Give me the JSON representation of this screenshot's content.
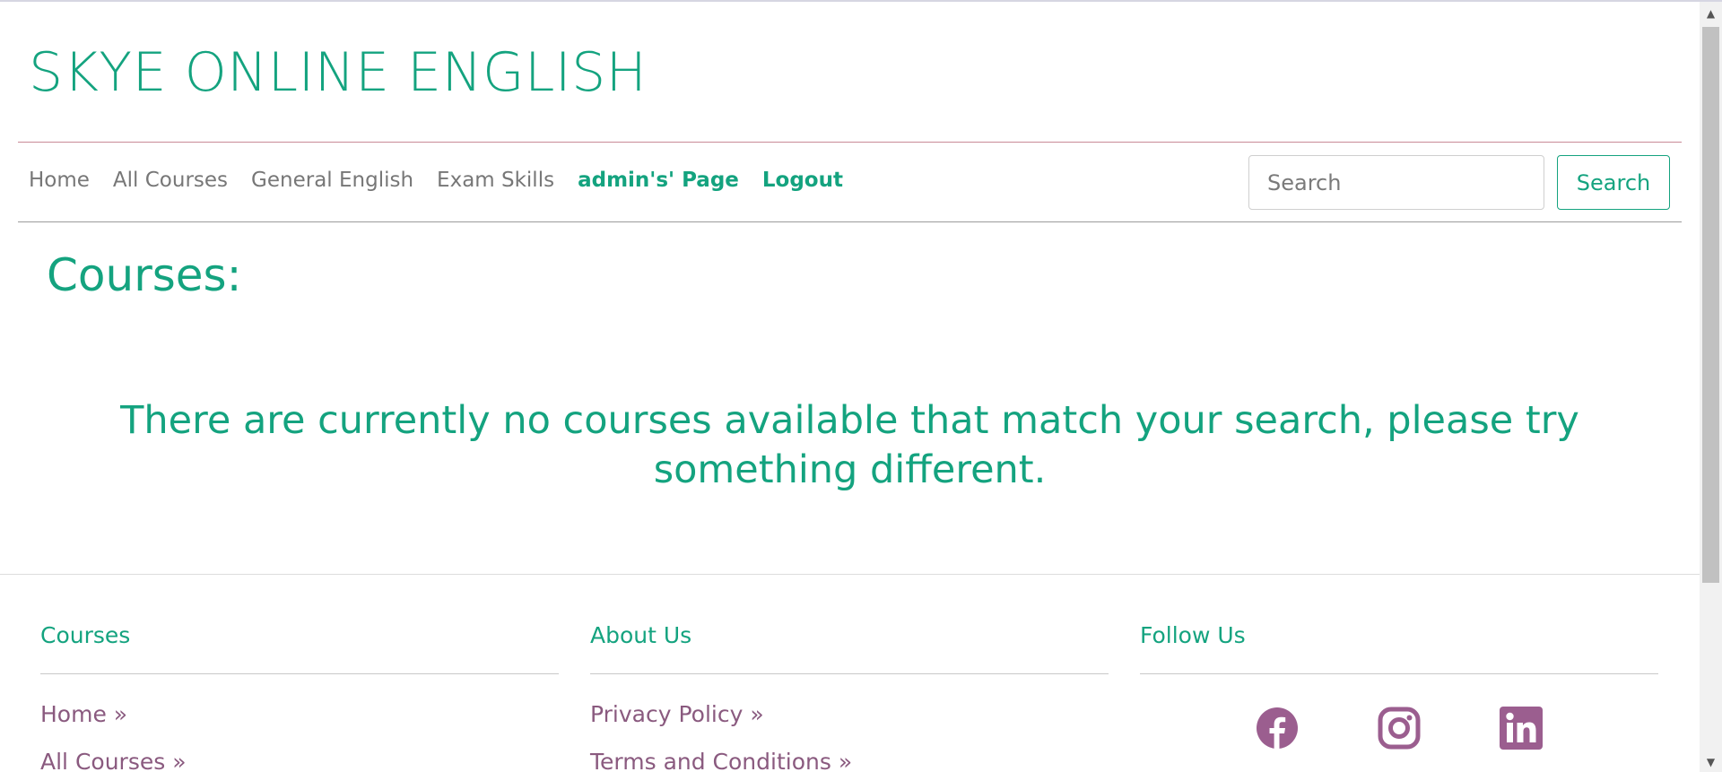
{
  "brand": {
    "title": "SKYE ONLINE ENGLISH"
  },
  "nav": {
    "items": [
      "Home",
      "All Courses",
      "General English",
      "Exam Skills"
    ],
    "admin_label": "admin's' Page",
    "logout_label": "Logout"
  },
  "search": {
    "placeholder": "Search",
    "button_label": "Search"
  },
  "main": {
    "heading": "Courses:",
    "empty_message": "There are currently no courses available that match your search, please try something different."
  },
  "footer": {
    "courses": {
      "heading": "Courses",
      "links": [
        "Home »",
        "All Courses »"
      ]
    },
    "about": {
      "heading": "About Us",
      "links": [
        "Privacy Policy »",
        "Terms and Conditions »"
      ]
    },
    "follow": {
      "heading": "Follow Us",
      "icons": [
        "facebook-icon",
        "instagram-icon",
        "linkedin-icon"
      ]
    }
  },
  "colors": {
    "accent": "#14a37f",
    "footer_link": "#8a5a7f",
    "nav_link": "#777777",
    "social": "#9b5e8f"
  }
}
